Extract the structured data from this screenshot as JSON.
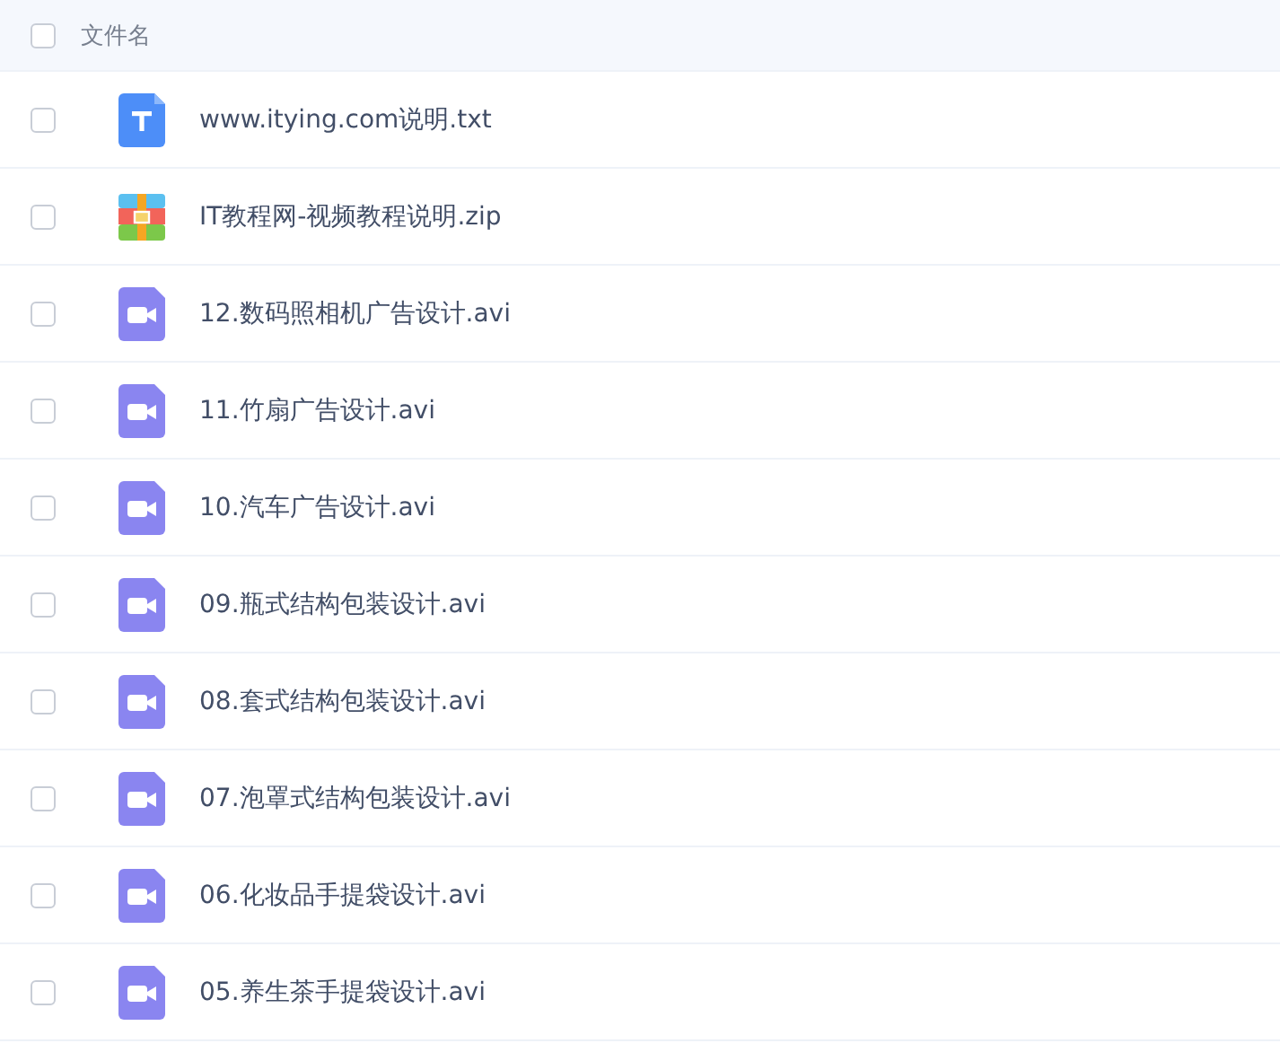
{
  "header": {
    "label": "文件名",
    "checked": false
  },
  "files": [
    {
      "name": "www.itying.com说明.txt",
      "kind": "text",
      "checked": false
    },
    {
      "name": "IT教程网-视频教程说明.zip",
      "kind": "archive",
      "checked": false
    },
    {
      "name": "12.数码照相机广告设计.avi",
      "kind": "video",
      "checked": false
    },
    {
      "name": "11.竹扇广告设计.avi",
      "kind": "video",
      "checked": false
    },
    {
      "name": "10.汽车广告设计.avi",
      "kind": "video",
      "checked": false
    },
    {
      "name": "09.瓶式结构包装设计.avi",
      "kind": "video",
      "checked": false
    },
    {
      "name": "08.套式结构包装设计.avi",
      "kind": "video",
      "checked": false
    },
    {
      "name": "07.泡罩式结构包装设计.avi",
      "kind": "video",
      "checked": false
    },
    {
      "name": "06.化妆品手提袋设计.avi",
      "kind": "video",
      "checked": false
    },
    {
      "name": "05.养生茶手提袋设计.avi",
      "kind": "video",
      "checked": false
    }
  ]
}
